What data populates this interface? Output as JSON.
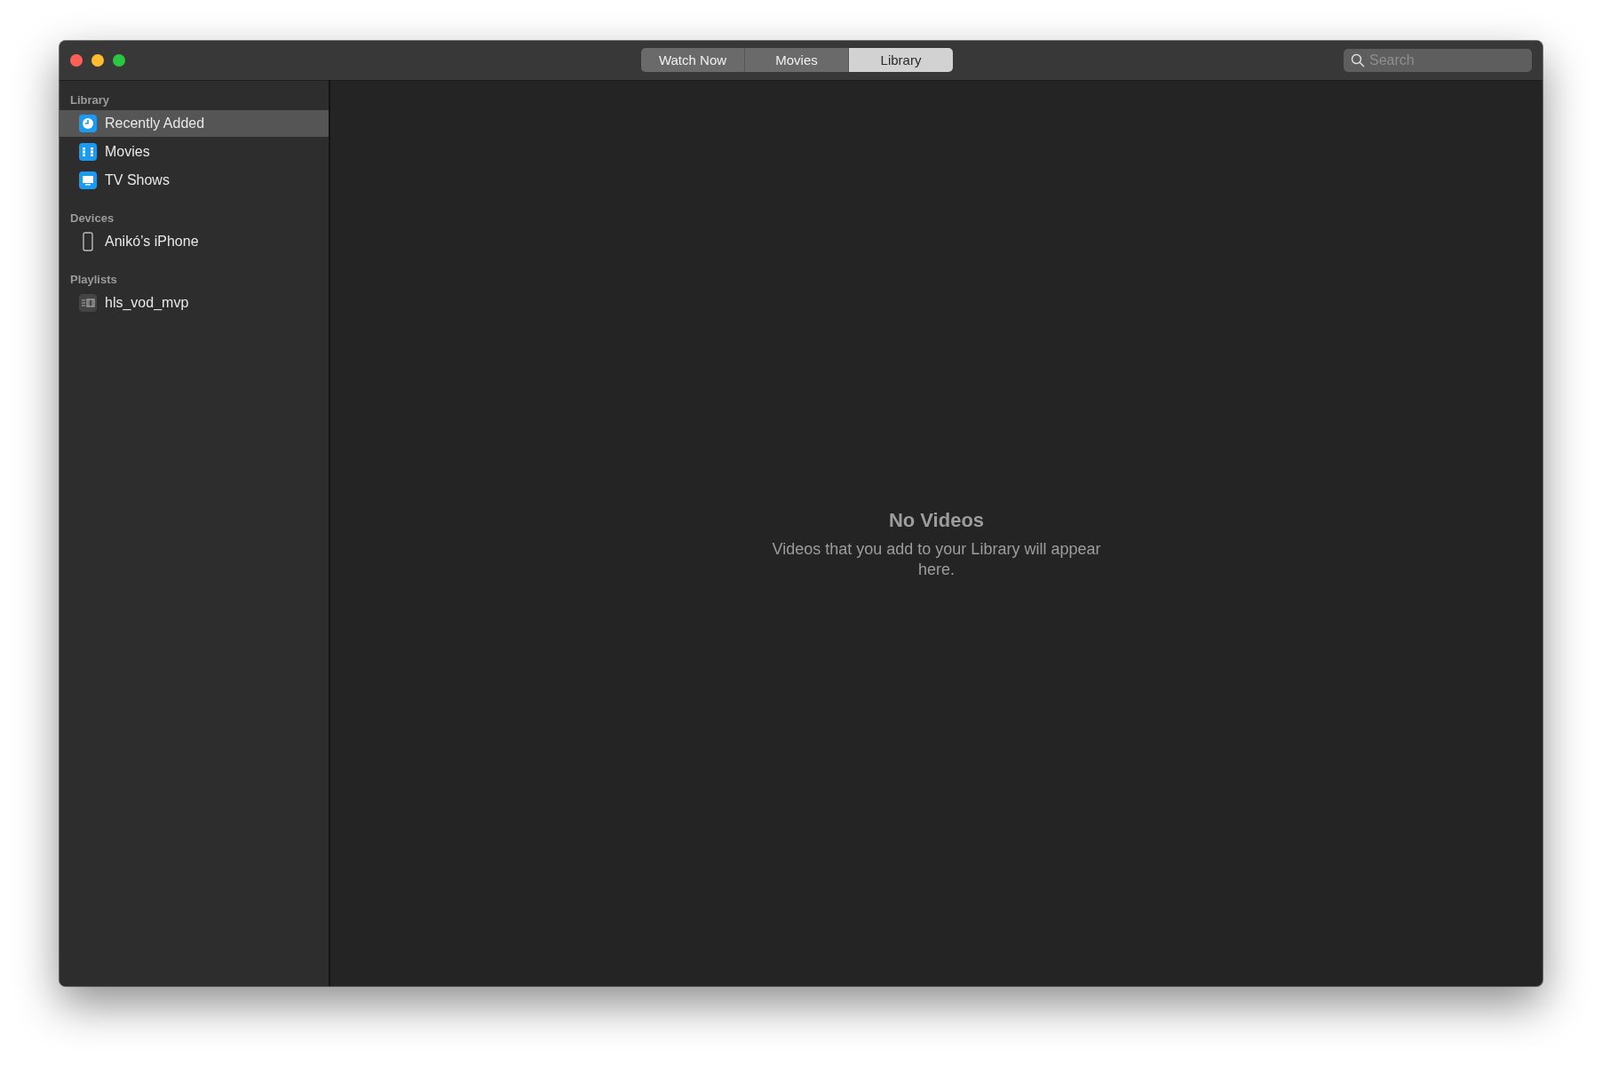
{
  "window": {
    "controls": [
      {
        "kind": "close"
      },
      {
        "kind": "minimize"
      },
      {
        "kind": "zoom"
      }
    ]
  },
  "tabs": [
    {
      "label": "Watch Now",
      "selected": false
    },
    {
      "label": "Movies",
      "selected": false
    },
    {
      "label": "Library",
      "selected": true
    }
  ],
  "search": {
    "placeholder": "Search"
  },
  "sidebar": {
    "sections": [
      {
        "title": "Library",
        "items": [
          {
            "label": "Recently Added",
            "kind": "clock",
            "selected": true
          },
          {
            "label": "Movies",
            "kind": "film",
            "selected": false
          },
          {
            "label": "TV Shows",
            "kind": "tv",
            "selected": false
          }
        ]
      },
      {
        "title": "Devices",
        "items": [
          {
            "label": "Anikó’s iPhone",
            "kind": "phone",
            "selected": false
          }
        ]
      },
      {
        "title": "Playlists",
        "items": [
          {
            "label": "hls_vod_mvp",
            "kind": "playlist",
            "selected": false
          }
        ]
      }
    ]
  },
  "empty_state": {
    "title": "No Videos",
    "message": "Videos that you add to your Library will appear here."
  }
}
